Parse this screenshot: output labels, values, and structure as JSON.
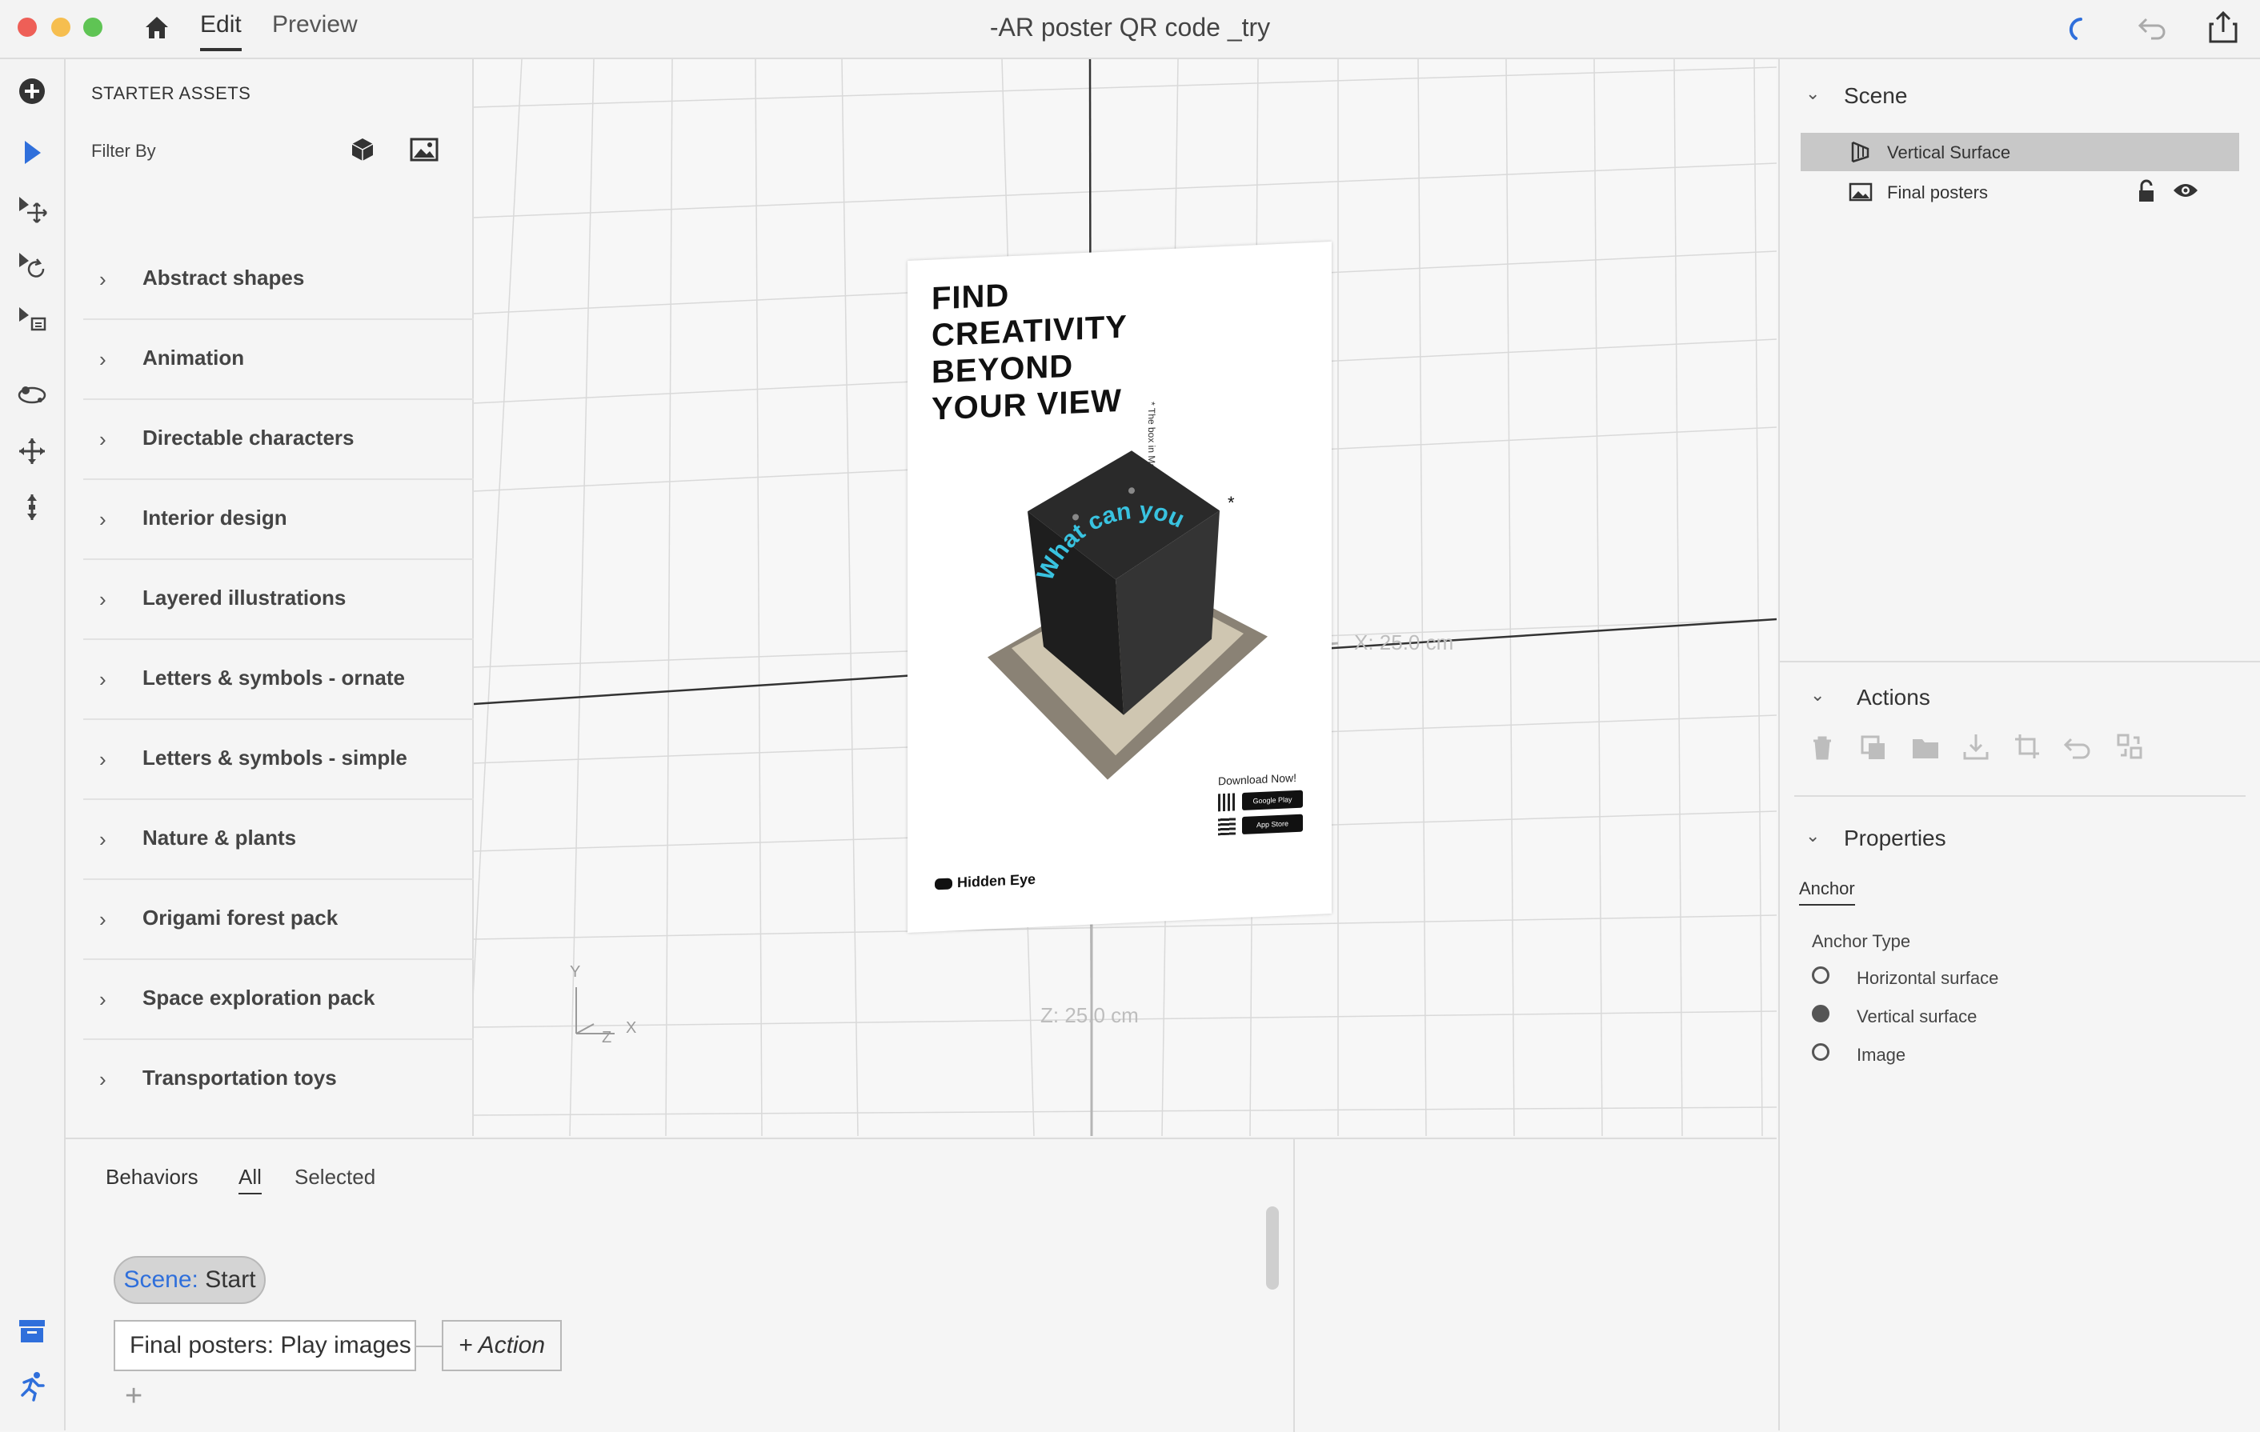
{
  "window": {
    "title": "-AR poster QR code _try",
    "tabs": [
      "Edit",
      "Preview"
    ],
    "active_tab": "Edit"
  },
  "assets": {
    "header": "STARTER ASSETS",
    "filter_label": "Filter By",
    "items": [
      "Abstract shapes",
      "Animation",
      "Directable characters",
      "Interior design",
      "Layered illustrations",
      "Letters & symbols - ornate",
      "Letters & symbols - simple",
      "Nature & plants",
      "Origami forest pack",
      "Space exploration pack",
      "Transportation toys"
    ]
  },
  "viewport": {
    "x_measure": "X: 25.0 cm",
    "z_measure": "Z: 25.0 cm",
    "axis_y": "Y",
    "axis_x": "X",
    "axis_z": "Z",
    "poster": {
      "headline": [
        "FIND",
        "CREATIVITY",
        "BEYOND",
        "YOUR VIEW"
      ],
      "side_note": "* The box in Madison Square Park",
      "curved_text": "What can you see beyond the box?",
      "asterisk": "*",
      "download": "Download Now!",
      "google_play": "Google Play",
      "app_store": "App Store",
      "brand": "Hidden Eye"
    }
  },
  "scene": {
    "title": "Scene",
    "items": [
      {
        "label": "Vertical Surface",
        "selected": true
      },
      {
        "label": "Final posters",
        "selected": false
      }
    ]
  },
  "actions": {
    "title": "Actions",
    "icons": [
      "trash-icon",
      "duplicate-icon",
      "folder-icon",
      "import-icon",
      "crop-icon",
      "undo-icon",
      "replace-icon"
    ]
  },
  "properties": {
    "title": "Properties",
    "tab": "Anchor",
    "anchor_type_label": "Anchor Type",
    "options": [
      "Horizontal surface",
      "Vertical surface",
      "Image"
    ],
    "selected_option": "Vertical surface"
  },
  "behaviors": {
    "title": "Behaviors",
    "tabs": [
      "All",
      "Selected"
    ],
    "active_tab": "All",
    "trigger_scene": "Scene:",
    "trigger_event": "Start",
    "action_label": "Final posters: Play images",
    "add_action": "+ Action",
    "add_icon": "+"
  },
  "colors": {
    "accent": "#2f6fdb",
    "selected_row": "#c8c8c8",
    "viewport_bg": "#f7f7f7",
    "poster_cyan": "#39c3e0"
  }
}
